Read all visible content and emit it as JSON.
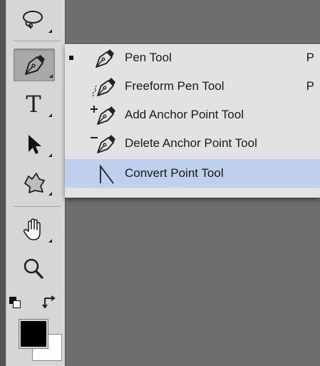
{
  "toolbar": {
    "tools": [
      {
        "name": "lasso-tool",
        "active": false
      },
      {
        "name": "pen-tool",
        "active": true
      },
      {
        "name": "type-tool",
        "glyph": "T",
        "active": false
      },
      {
        "name": "path-selection-tool",
        "active": false
      },
      {
        "name": "custom-shape-tool",
        "active": false
      },
      {
        "name": "hand-tool",
        "active": false
      },
      {
        "name": "zoom-tool",
        "active": false
      }
    ],
    "colors": {
      "foreground": "#000000",
      "background": "#ffffff"
    }
  },
  "flyout": {
    "items": [
      {
        "label": "Pen Tool",
        "shortcut": "P",
        "icon": "pen-icon",
        "selected": true
      },
      {
        "label": "Freeform Pen Tool",
        "shortcut": "P",
        "icon": "freeform-pen-icon",
        "selected": false
      },
      {
        "label": "Add Anchor Point Tool",
        "shortcut": "",
        "icon": "add-anchor-point-icon",
        "selected": false
      },
      {
        "label": "Delete Anchor Point Tool",
        "shortcut": "",
        "icon": "delete-anchor-point-icon",
        "selected": false
      },
      {
        "label": "Convert Point Tool",
        "shortcut": "",
        "icon": "convert-point-icon",
        "selected": false,
        "highlighted": true
      }
    ]
  },
  "colors": {
    "canvas": "#6e6e6e",
    "panel": "#d6d6d6",
    "menu": "#e2e2e2",
    "highlight": "#bfd0ee"
  }
}
